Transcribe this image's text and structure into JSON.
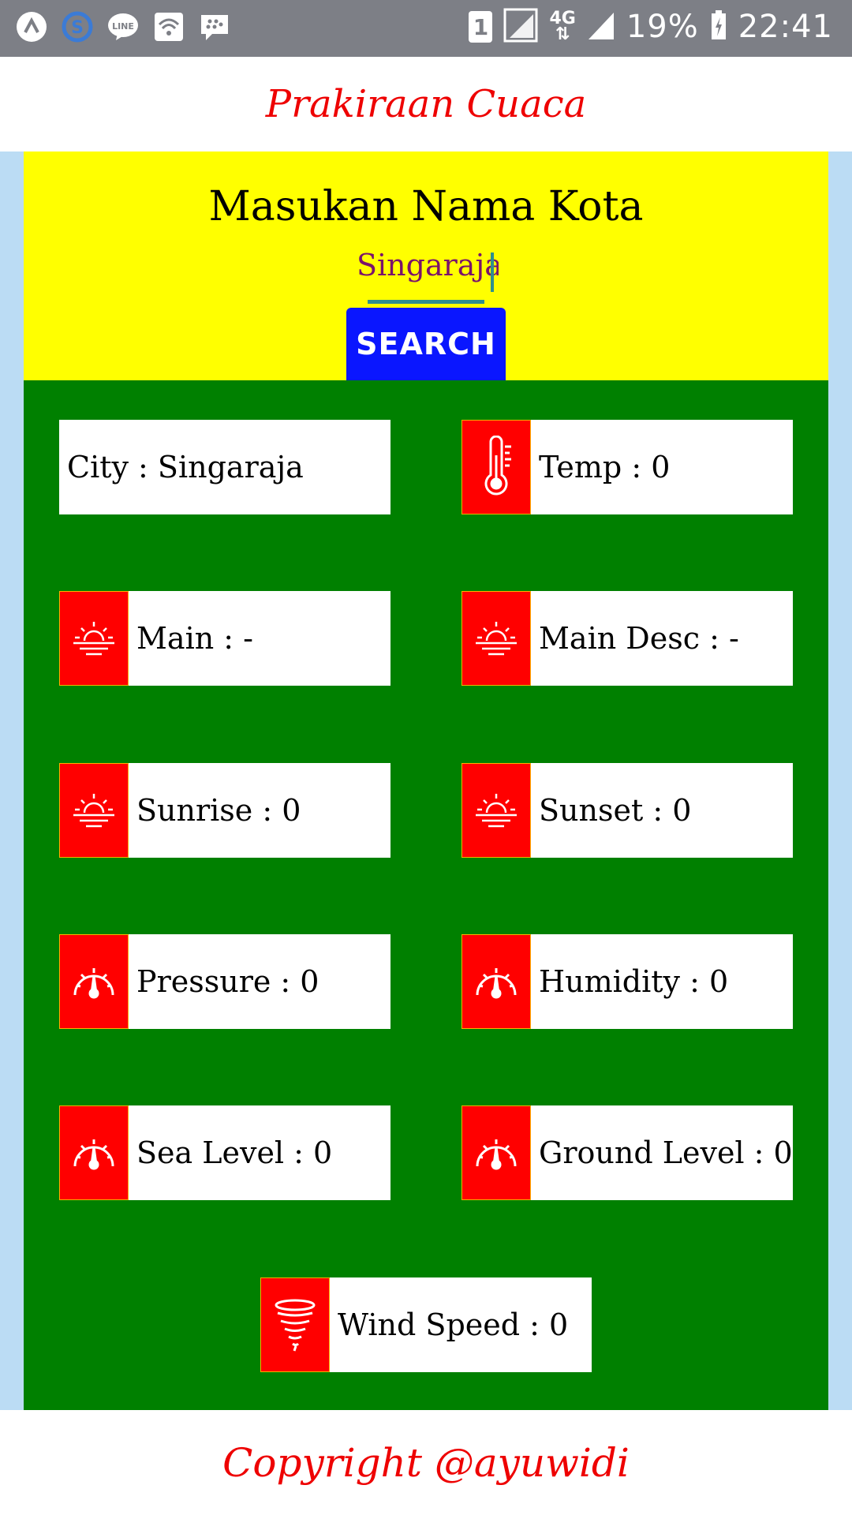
{
  "status_bar": {
    "left_icons": [
      "app-icon",
      "skype-icon",
      "line-icon",
      "wifi-icon",
      "bbm-icon"
    ],
    "sim_label": "1",
    "network_label": "4G",
    "battery": "19%",
    "time": "22:41"
  },
  "appbar": {
    "title": "Prakiraan Cuaca"
  },
  "search": {
    "heading": "Masukan Nama Kota",
    "city_value": "Singaraja",
    "button_label": "SEARCH"
  },
  "cards": [
    {
      "label": "City : Singaraja",
      "icon": "none"
    },
    {
      "label": "Temp : 0",
      "icon": "thermometer-icon"
    },
    {
      "label": "Main : -",
      "icon": "sunrise-icon"
    },
    {
      "label": "Main Desc : -",
      "icon": "sunrise-icon"
    },
    {
      "label": "Sunrise : 0",
      "icon": "sunrise-icon"
    },
    {
      "label": "Sunset : 0",
      "icon": "sunrise-icon"
    },
    {
      "label": "Pressure : 0",
      "icon": "gauge-icon"
    },
    {
      "label": "Humidity : 0",
      "icon": "gauge-icon"
    },
    {
      "label": "Sea Level : 0",
      "icon": "gauge-icon"
    },
    {
      "label": "Ground Level : 0",
      "icon": "gauge-icon"
    },
    {
      "label": "Wind Speed : 0",
      "icon": "tornado-icon"
    }
  ],
  "footer": {
    "text": "Copyright @ayuwidi"
  },
  "colors": {
    "title_red": "#ee0000",
    "search_panel": "#ffff00",
    "search_button": "#0a16ff",
    "content_green": "#008000",
    "icon_red": "#ff0000"
  }
}
